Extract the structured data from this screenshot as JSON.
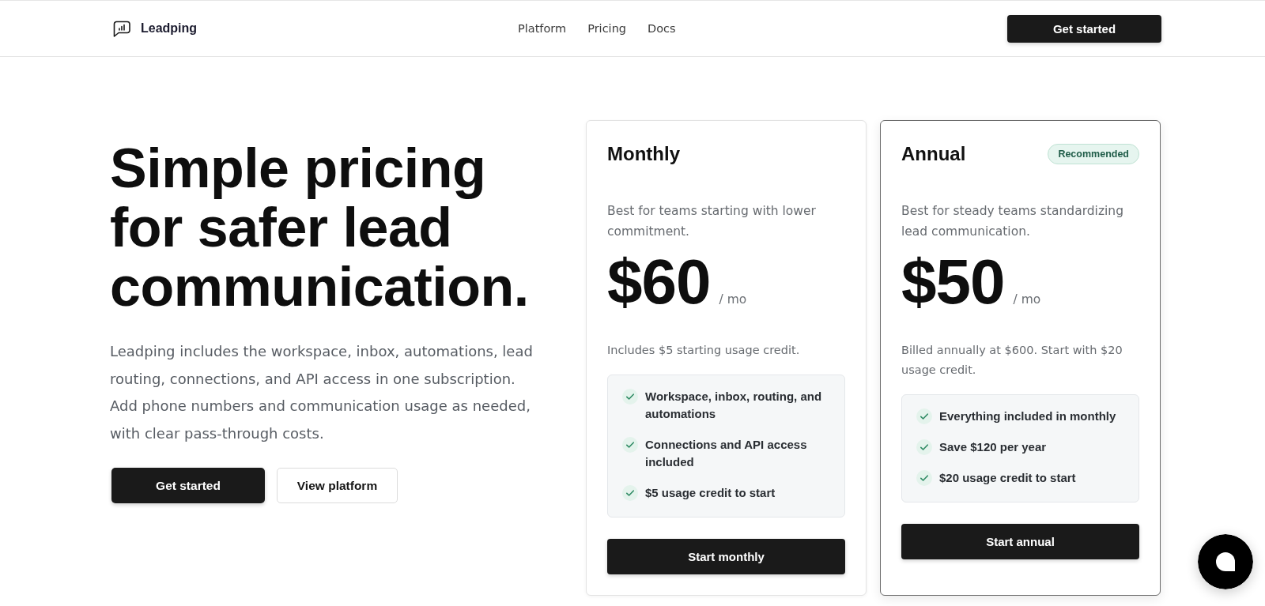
{
  "header": {
    "brand": "Leadping",
    "nav": [
      "Platform",
      "Pricing",
      "Docs"
    ],
    "cta": "Get started"
  },
  "hero": {
    "title": "Simple pricing for safer lead communication.",
    "description": "Leadping includes the workspace, inbox, automations, lead routing, connections, and API access in one subscription. Add phone numbers and communication usage as needed, with clear pass-through costs.",
    "buttons": [
      {
        "label": "Get started",
        "kind": "primary"
      },
      {
        "label": "View platform",
        "kind": "secondary"
      }
    ]
  },
  "plans": [
    {
      "name": "Monthly",
      "highlighted": false,
      "description": "Best for teams starting with lower commitment.",
      "price": "$60",
      "period": "/ mo",
      "note": "Includes $5 starting usage credit.",
      "features": [
        "Workspace, inbox, routing, and automations",
        "Connections and API access included",
        "$5 usage credit to start"
      ],
      "button": "Start monthly"
    },
    {
      "name": "Annual",
      "badge": "Recommended",
      "highlighted": true,
      "description": "Best for steady teams standardizing lead communication.",
      "price": "$50",
      "period": "/ mo",
      "note": "Billed annually at $600. Start with $20 usage credit.",
      "features": [
        "Everything included in monthly",
        "Save $120 per year",
        "$20 usage credit to start"
      ],
      "button": "Start annual"
    }
  ]
}
